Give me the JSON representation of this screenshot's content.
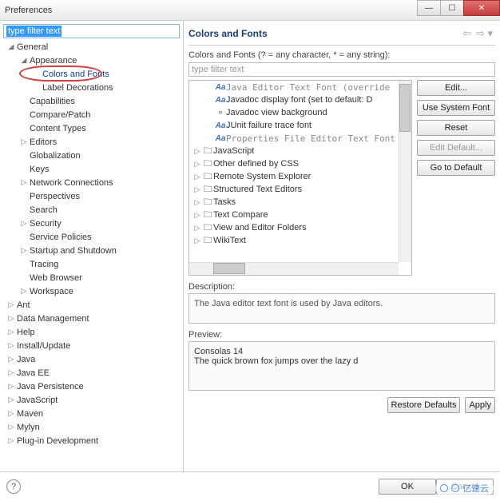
{
  "window": {
    "title": "Preferences"
  },
  "left": {
    "filter": "type filter text",
    "tree": [
      {
        "d": 0,
        "exp": "open",
        "label": "General"
      },
      {
        "d": 1,
        "exp": "open",
        "label": "Appearance"
      },
      {
        "d": 2,
        "exp": "",
        "label": "Colors and Fonts",
        "sel": true,
        "ring": true
      },
      {
        "d": 2,
        "exp": "",
        "label": "Label Decorations"
      },
      {
        "d": 1,
        "exp": "",
        "label": "Capabilities"
      },
      {
        "d": 1,
        "exp": "",
        "label": "Compare/Patch"
      },
      {
        "d": 1,
        "exp": "",
        "label": "Content Types"
      },
      {
        "d": 1,
        "exp": "closed",
        "label": "Editors"
      },
      {
        "d": 1,
        "exp": "",
        "label": "Globalization"
      },
      {
        "d": 1,
        "exp": "",
        "label": "Keys"
      },
      {
        "d": 1,
        "exp": "closed",
        "label": "Network Connections"
      },
      {
        "d": 1,
        "exp": "",
        "label": "Perspectives"
      },
      {
        "d": 1,
        "exp": "",
        "label": "Search"
      },
      {
        "d": 1,
        "exp": "closed",
        "label": "Security"
      },
      {
        "d": 1,
        "exp": "",
        "label": "Service Policies"
      },
      {
        "d": 1,
        "exp": "closed",
        "label": "Startup and Shutdown"
      },
      {
        "d": 1,
        "exp": "",
        "label": "Tracing"
      },
      {
        "d": 1,
        "exp": "",
        "label": "Web Browser"
      },
      {
        "d": 1,
        "exp": "closed",
        "label": "Workspace"
      },
      {
        "d": 0,
        "exp": "closed",
        "label": "Ant"
      },
      {
        "d": 0,
        "exp": "closed",
        "label": "Data Management"
      },
      {
        "d": 0,
        "exp": "closed",
        "label": "Help"
      },
      {
        "d": 0,
        "exp": "closed",
        "label": "Install/Update"
      },
      {
        "d": 0,
        "exp": "closed",
        "label": "Java"
      },
      {
        "d": 0,
        "exp": "closed",
        "label": "Java EE"
      },
      {
        "d": 0,
        "exp": "closed",
        "label": "Java Persistence"
      },
      {
        "d": 0,
        "exp": "closed",
        "label": "JavaScript"
      },
      {
        "d": 0,
        "exp": "closed",
        "label": "Maven"
      },
      {
        "d": 0,
        "exp": "closed",
        "label": "Mylyn"
      },
      {
        "d": 0,
        "exp": "closed",
        "label": "Plug-in Development"
      }
    ]
  },
  "right": {
    "title": "Colors and Fonts",
    "hint": "Colors and Fonts (? = any character, * = any string):",
    "filter_placeholder": "type filter text",
    "items": [
      {
        "d": 1,
        "ico": "aa",
        "txt": "Java Editor Text Font (override",
        "grey": true
      },
      {
        "d": 1,
        "ico": "aa",
        "txt": "Javadoc display font (set to default: D"
      },
      {
        "d": 1,
        "ico": "sq",
        "txt": "Javadoc view background"
      },
      {
        "d": 1,
        "ico": "aa",
        "txt": "JUnit failure trace font"
      },
      {
        "d": 1,
        "ico": "aa",
        "txt": "Properties File Editor Text Font",
        "grey": true
      },
      {
        "d": 0,
        "exp": "closed",
        "ico": "fld",
        "txt": "JavaScript"
      },
      {
        "d": 0,
        "exp": "closed",
        "ico": "fld",
        "txt": "Other defined by CSS"
      },
      {
        "d": 0,
        "exp": "closed",
        "ico": "fld",
        "txt": "Remote System Explorer"
      },
      {
        "d": 0,
        "exp": "closed",
        "ico": "fld",
        "txt": "Structured Text Editors"
      },
      {
        "d": 0,
        "exp": "closed",
        "ico": "fld",
        "txt": "Tasks"
      },
      {
        "d": 0,
        "exp": "closed",
        "ico": "fld",
        "txt": "Text Compare"
      },
      {
        "d": 0,
        "exp": "closed",
        "ico": "fld",
        "txt": "View and Editor Folders"
      },
      {
        "d": 0,
        "exp": "closed",
        "ico": "fld",
        "txt": "WikiText"
      }
    ],
    "buttons": {
      "edit": "Edit...",
      "system": "Use System Font",
      "reset": "Reset",
      "editdef": "Edit Default...",
      "gotodef": "Go to Default"
    },
    "desc_label": "Description:",
    "desc_text": "The Java editor text font is used by Java editors.",
    "prev_label": "Preview:",
    "prev_line1": "Consolas 14",
    "prev_line2": "The quick brown fox jumps over the lazy d",
    "restore": "Restore Defaults",
    "apply": "Apply"
  },
  "footer": {
    "ok": "OK",
    "cancel": "Cancel"
  },
  "watermark": "亿速云"
}
